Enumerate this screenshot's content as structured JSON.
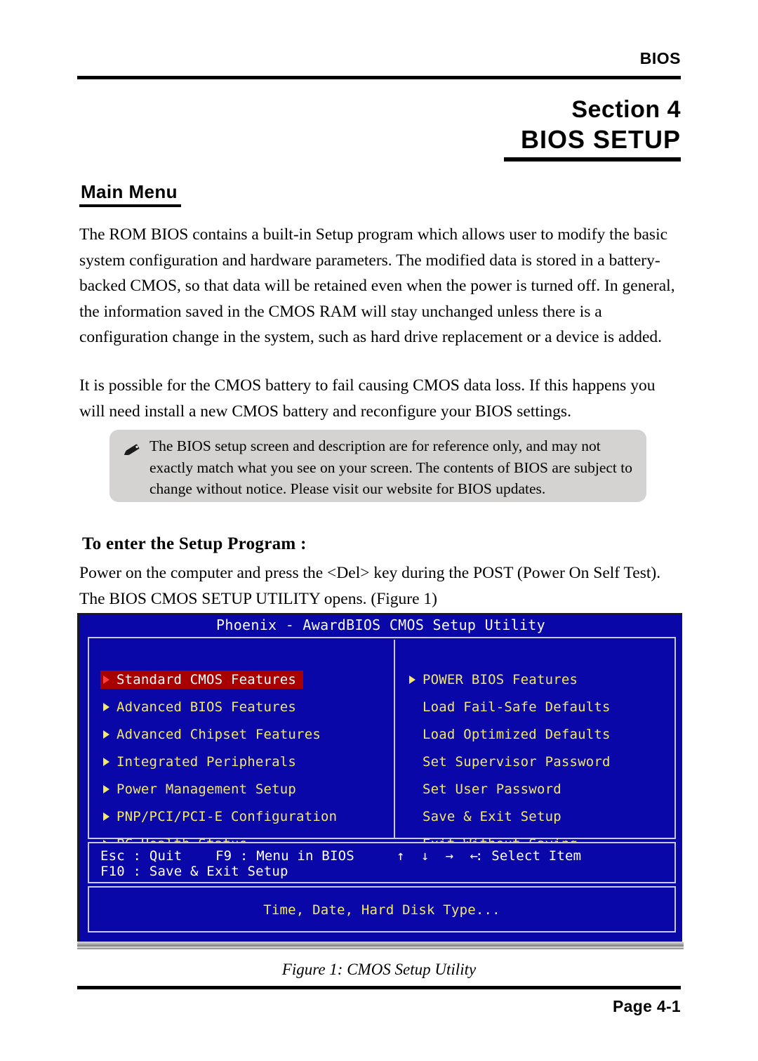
{
  "header": {
    "label": "BIOS"
  },
  "section": {
    "number_line": "Section 4",
    "title_line": "BIOS SETUP"
  },
  "main_menu": {
    "heading": "Main Menu",
    "paragraph1": "The ROM BIOS contains a built-in Setup program which allows user to modify the basic system configuration and hardware parameters. The modified data is stored in a battery-backed CMOS, so that data will be retained even when the power is turned off. In general, the information saved in the CMOS RAM will stay unchanged unless there is a configuration change in the system, such as hard drive replacement or a device is added.",
    "paragraph2": "It is possible for the CMOS battery to fail causing CMOS data loss. If this happens you will need install a new CMOS battery and reconfigure your BIOS settings."
  },
  "note": {
    "icon": "pencil-icon",
    "text": "The BIOS setup screen and description are for reference only, and may not exactly match what you see on your screen. The contents of BIOS are subject to change without notice. Please visit our website for BIOS updates.",
    "background_color": "#d4d3d2"
  },
  "setup_program": {
    "heading": "To enter the Setup Program :",
    "paragraph": "Power on the computer and press the <Del> key during the POST (Power On Self Test). The BIOS CMOS SETUP UTILITY opens. (Figure 1)"
  },
  "bios_screen": {
    "title": "Phoenix - AwardBIOS CMOS Setup Utility",
    "colors": {
      "background": "#0a07a8",
      "border": "#c9c9ef",
      "menu_text": "#f2e86a",
      "highlight_background": "#a80000",
      "highlight_text": "#ffffff",
      "help_text": "#ffffff"
    },
    "left_menu": [
      {
        "label": "Standard CMOS Features",
        "bullet": true,
        "selected": true
      },
      {
        "label": "Advanced BIOS Features",
        "bullet": true,
        "selected": false
      },
      {
        "label": "Advanced Chipset Features",
        "bullet": true,
        "selected": false
      },
      {
        "label": "Integrated Peripherals",
        "bullet": true,
        "selected": false
      },
      {
        "label": "Power Management Setup",
        "bullet": true,
        "selected": false
      },
      {
        "label": "PNP/PCI/PCI-E Configuration",
        "bullet": true,
        "selected": false
      },
      {
        "label": "PC Health Status",
        "bullet": true,
        "selected": false
      }
    ],
    "right_menu": [
      {
        "label": "POWER BIOS Features",
        "bullet": true,
        "selected": false
      },
      {
        "label": "Load Fail-Safe Defaults",
        "bullet": false,
        "selected": false
      },
      {
        "label": "Load Optimized Defaults",
        "bullet": false,
        "selected": false
      },
      {
        "label": "Set Supervisor Password",
        "bullet": false,
        "selected": false
      },
      {
        "label": "Set User Password",
        "bullet": false,
        "selected": false
      },
      {
        "label": "Save & Exit Setup",
        "bullet": false,
        "selected": false
      },
      {
        "label": "Exit Without Saving",
        "bullet": false,
        "selected": false
      }
    ],
    "help_bar": {
      "esc": "Esc : Quit",
      "f9": "F9 : Menu in BIOS",
      "arrows": "↑ ↓ → ←",
      "select_item": ": Select Item",
      "f10": "F10 : Save & Exit Setup"
    },
    "status_line": "Time, Date, Hard Disk Type..."
  },
  "figure": {
    "caption": "Figure 1: CMOS Setup Utility"
  },
  "footer": {
    "page": "Page 4-1"
  }
}
